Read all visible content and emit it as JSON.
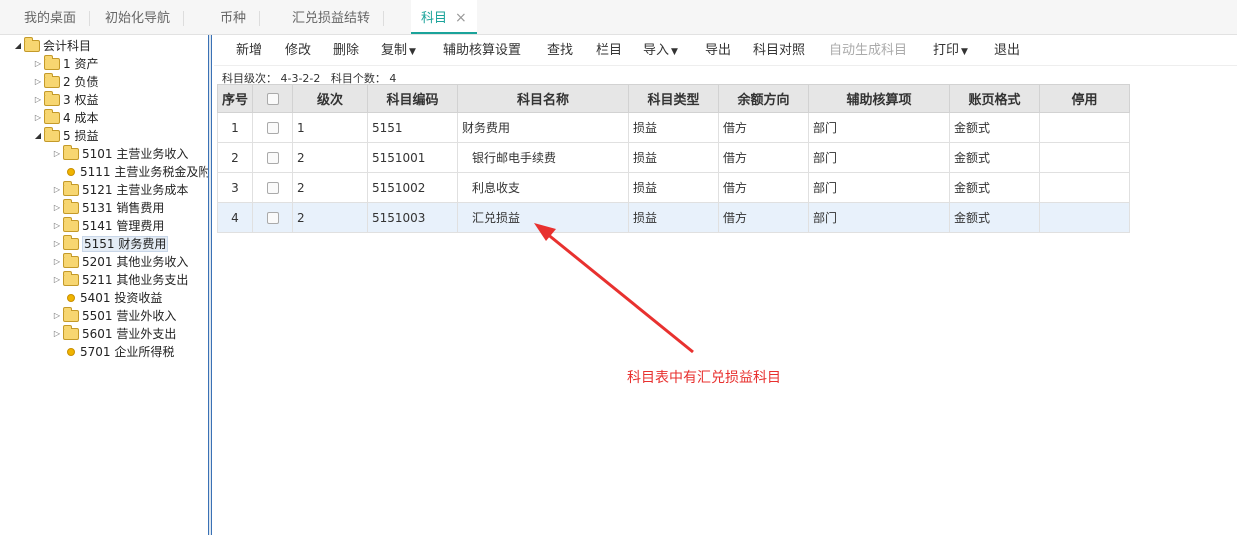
{
  "tabs": [
    {
      "label": "我的桌面"
    },
    {
      "label": "初始化导航"
    },
    {
      "label": "币种"
    },
    {
      "label": "汇兑损益结转"
    },
    {
      "label": "科目",
      "close": "×"
    }
  ],
  "tree": {
    "root": "会计科目",
    "groups": [
      "1 资产",
      "2 负债",
      "3 权益",
      "4 成本",
      "5 损益"
    ],
    "children": [
      "5101 主营业务收入",
      "5111 主营业务税金及附",
      "5121 主营业务成本",
      "5131 销售费用",
      "5141 管理费用",
      "5151 财务费用",
      "5201 其他业务收入",
      "5211 其他业务支出",
      "5401 投资收益",
      "5501 营业外收入",
      "5601 营业外支出",
      "5701 企业所得税"
    ]
  },
  "toolbar": {
    "add": "新增",
    "edit": "修改",
    "delete": "删除",
    "copy": "复制",
    "aux_settings": "辅助核算设置",
    "find": "查找",
    "columns": "栏目",
    "import": "导入",
    "export": "导出",
    "mapping": "科目对照",
    "auto_gen": "自动生成科目",
    "print": "打印",
    "exit": "退出"
  },
  "info": {
    "level_label": "科目级次：",
    "level_value": "4-3-2-2",
    "count_label": "科目个数：",
    "count_value": "4"
  },
  "table": {
    "headers": [
      "序号",
      "",
      "级次",
      "科目编码",
      "科目名称",
      "科目类型",
      "余额方向",
      "辅助核算项",
      "账页格式",
      "停用"
    ],
    "rows": [
      {
        "no": "1",
        "level": "1",
        "code": "5151",
        "name": "财务费用",
        "type": "损益",
        "dir": "借方",
        "aux": "部门",
        "format": "金额式",
        "disabled": ""
      },
      {
        "no": "2",
        "level": "2",
        "code": "5151001",
        "name": "银行邮电手续费",
        "type": "损益",
        "dir": "借方",
        "aux": "部门",
        "format": "金额式",
        "disabled": ""
      },
      {
        "no": "3",
        "level": "2",
        "code": "5151002",
        "name": "利息收支",
        "type": "损益",
        "dir": "借方",
        "aux": "部门",
        "format": "金额式",
        "disabled": ""
      },
      {
        "no": "4",
        "level": "2",
        "code": "5151003",
        "name": "汇兑损益",
        "type": "损益",
        "dir": "借方",
        "aux": "部门",
        "format": "金额式",
        "disabled": ""
      }
    ]
  },
  "annotation": "科目表中有汇兑损益科目",
  "colors": {
    "accent": "#1aa39a",
    "annotation": "#e8312f",
    "selected_row": "#e8f1fb"
  }
}
